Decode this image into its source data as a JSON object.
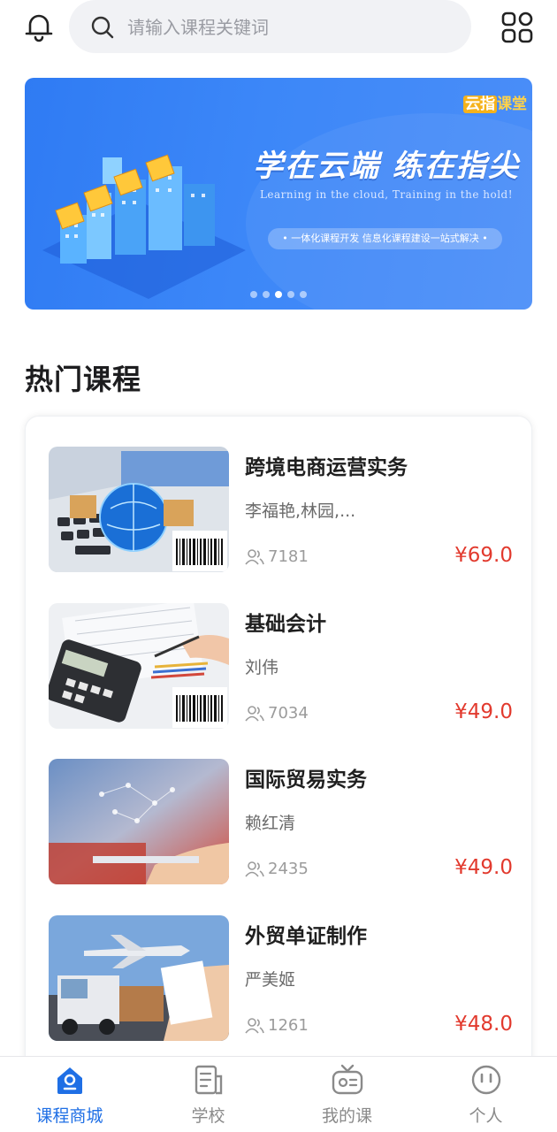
{
  "search": {
    "placeholder": "请输入课程关键词"
  },
  "banner": {
    "brand_part1": "云指",
    "brand_part2": "课堂",
    "headline": "学在云端  练在指尖",
    "subline": "Learning in the cloud, Training in the hold!",
    "pill_text": "• 一体化课程开发 信息化课程建设一站式解决 •",
    "slide_count": 5,
    "active_slide": 3
  },
  "section_title": "热门课程",
  "courses": [
    {
      "title": "跨境电商运营实务",
      "teacher": "李福艳,林园,...",
      "students": "7181",
      "price": "¥69.0"
    },
    {
      "title": "基础会计",
      "teacher": "刘伟",
      "students": "7034",
      "price": "¥49.0"
    },
    {
      "title": "国际贸易实务",
      "teacher": "赖红清",
      "students": "2435",
      "price": "¥49.0"
    },
    {
      "title": "外贸单证制作",
      "teacher": "严美姬",
      "students": "1261",
      "price": "¥48.0"
    }
  ],
  "nav": [
    {
      "label": "课程商城",
      "icon": "store-icon",
      "active": true
    },
    {
      "label": "学校",
      "icon": "school-icon",
      "active": false
    },
    {
      "label": "我的课",
      "icon": "tv-icon",
      "active": false
    },
    {
      "label": "个人",
      "icon": "profile-icon",
      "active": false
    }
  ],
  "colors": {
    "accent": "#1f6fe5",
    "price": "#e23a2e",
    "banner": "#3c87f8"
  }
}
